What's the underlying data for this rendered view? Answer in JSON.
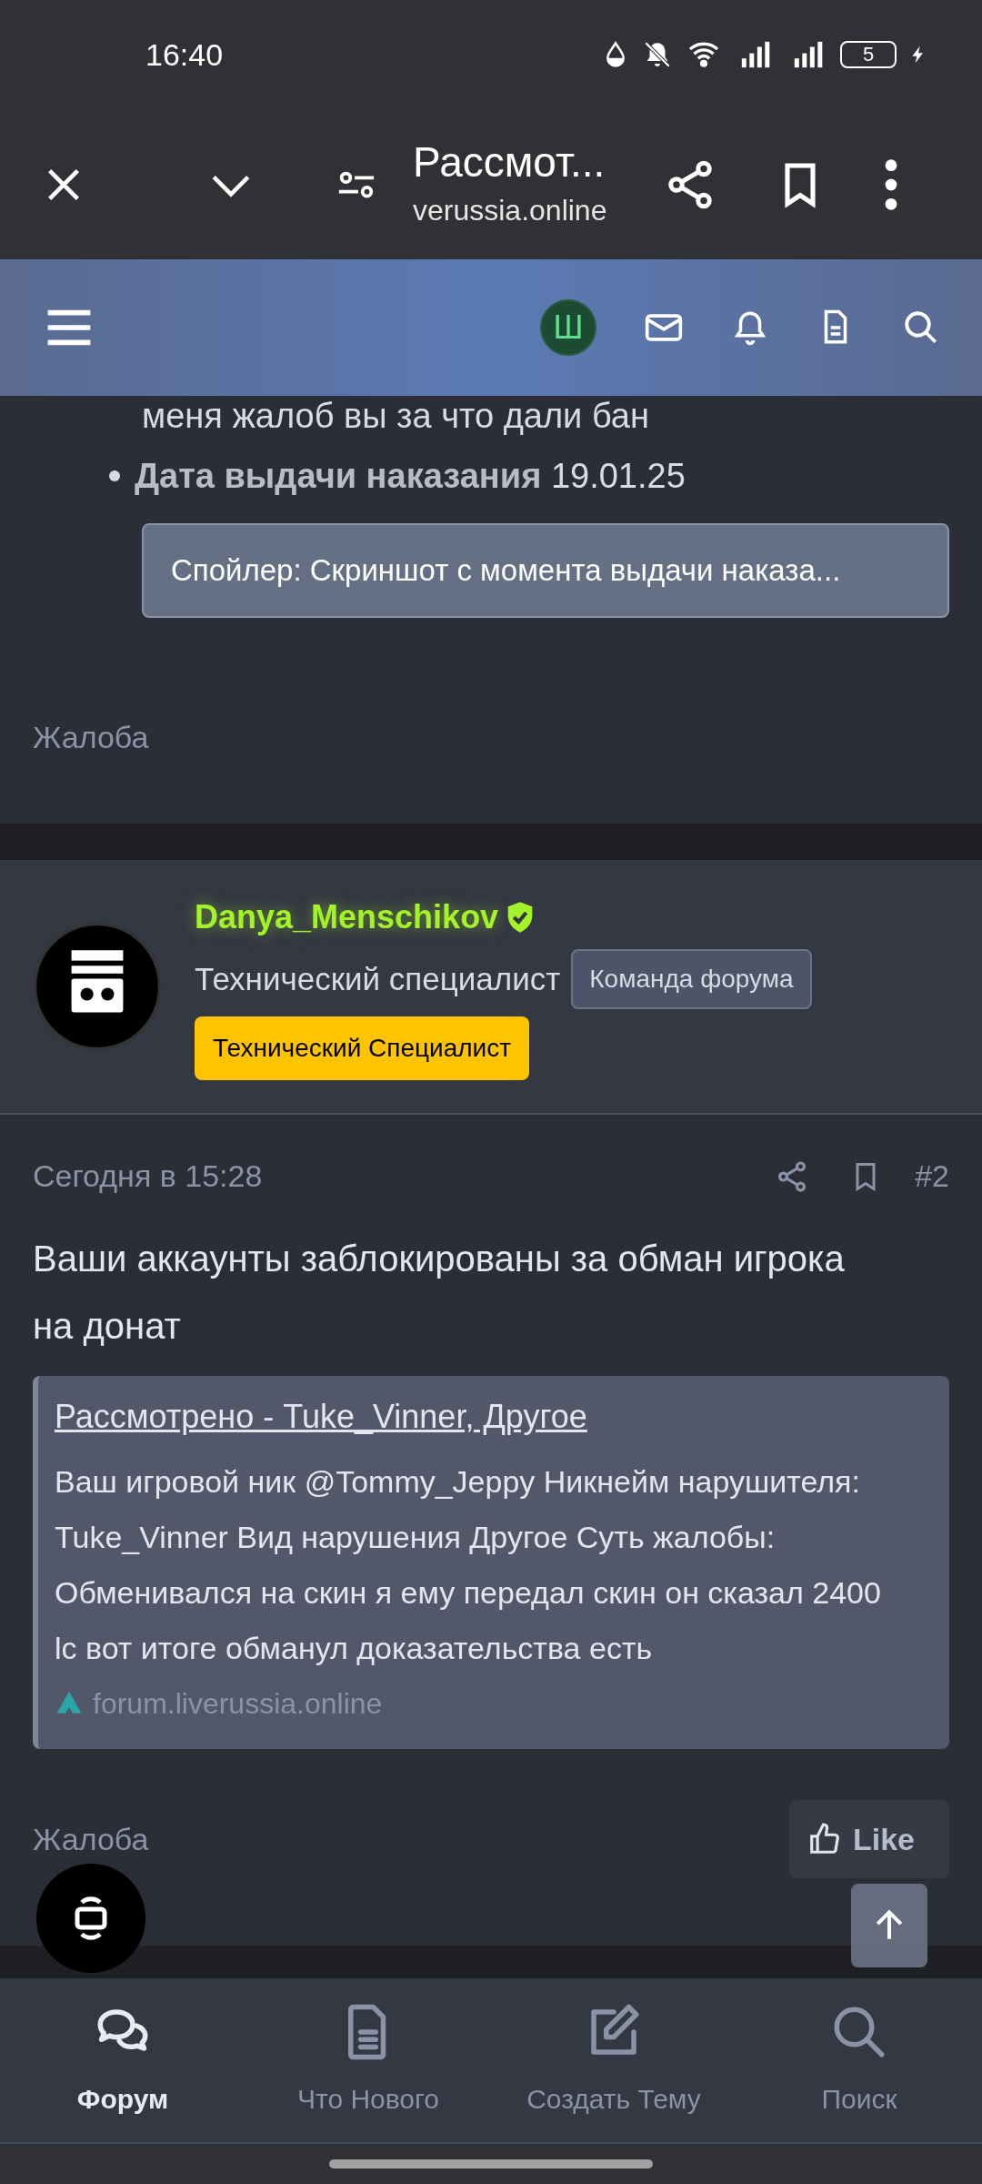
{
  "status_bar": {
    "time": "16:40",
    "battery": "5"
  },
  "browser_bar": {
    "title": "Рассмот...",
    "url": "verussia.online"
  },
  "forum_header": {
    "avatar_letter": "Ш"
  },
  "post_1": {
    "items": [
      {
        "kind": "text",
        "text": "меня жалоб вы за что дали бан"
      },
      {
        "kind": "bullet",
        "text": "**Дата выдачи наказания** 19.01.25"
      }
    ],
    "spoiler": "Спойлер: Скриншот с момента выдачи наказа...",
    "report": "Жалоба"
  },
  "post_2": {
    "author": {
      "name": "Danya_Menschikov",
      "verified": true,
      "title": "Технический специалист",
      "badge": "Команда форума",
      "role": "Технический Специалист"
    },
    "date": "Сегодня в 15:28",
    "number": "#2",
    "text": "Ваши аккаунты заблокированы за обман игрока на донат",
    "embed": {
      "title": "Рассмотрено - Tuke_Vinner, Другое",
      "text": "Ваш игровой ник @Tommy_Jeppy Никнейм нарушителя: Tuke_Vinner Вид нарушения Другое Суть жалобы: Обменивался на скин я ему передал скин он сказал 2400 lc вот итоге обманул доказательства есть",
      "source": "forum.liverussia.online"
    },
    "report": "Жалоба",
    "like": "Like"
  },
  "bottom_nav": [
    {
      "kind": "forum",
      "label": "Форум",
      "selected": true
    },
    {
      "kind": "new",
      "label": "Что Нового",
      "selected": false
    },
    {
      "kind": "create",
      "label": "Создать Тему",
      "selected": false
    },
    {
      "kind": "search",
      "label": "Поиск",
      "selected": false
    }
  ]
}
